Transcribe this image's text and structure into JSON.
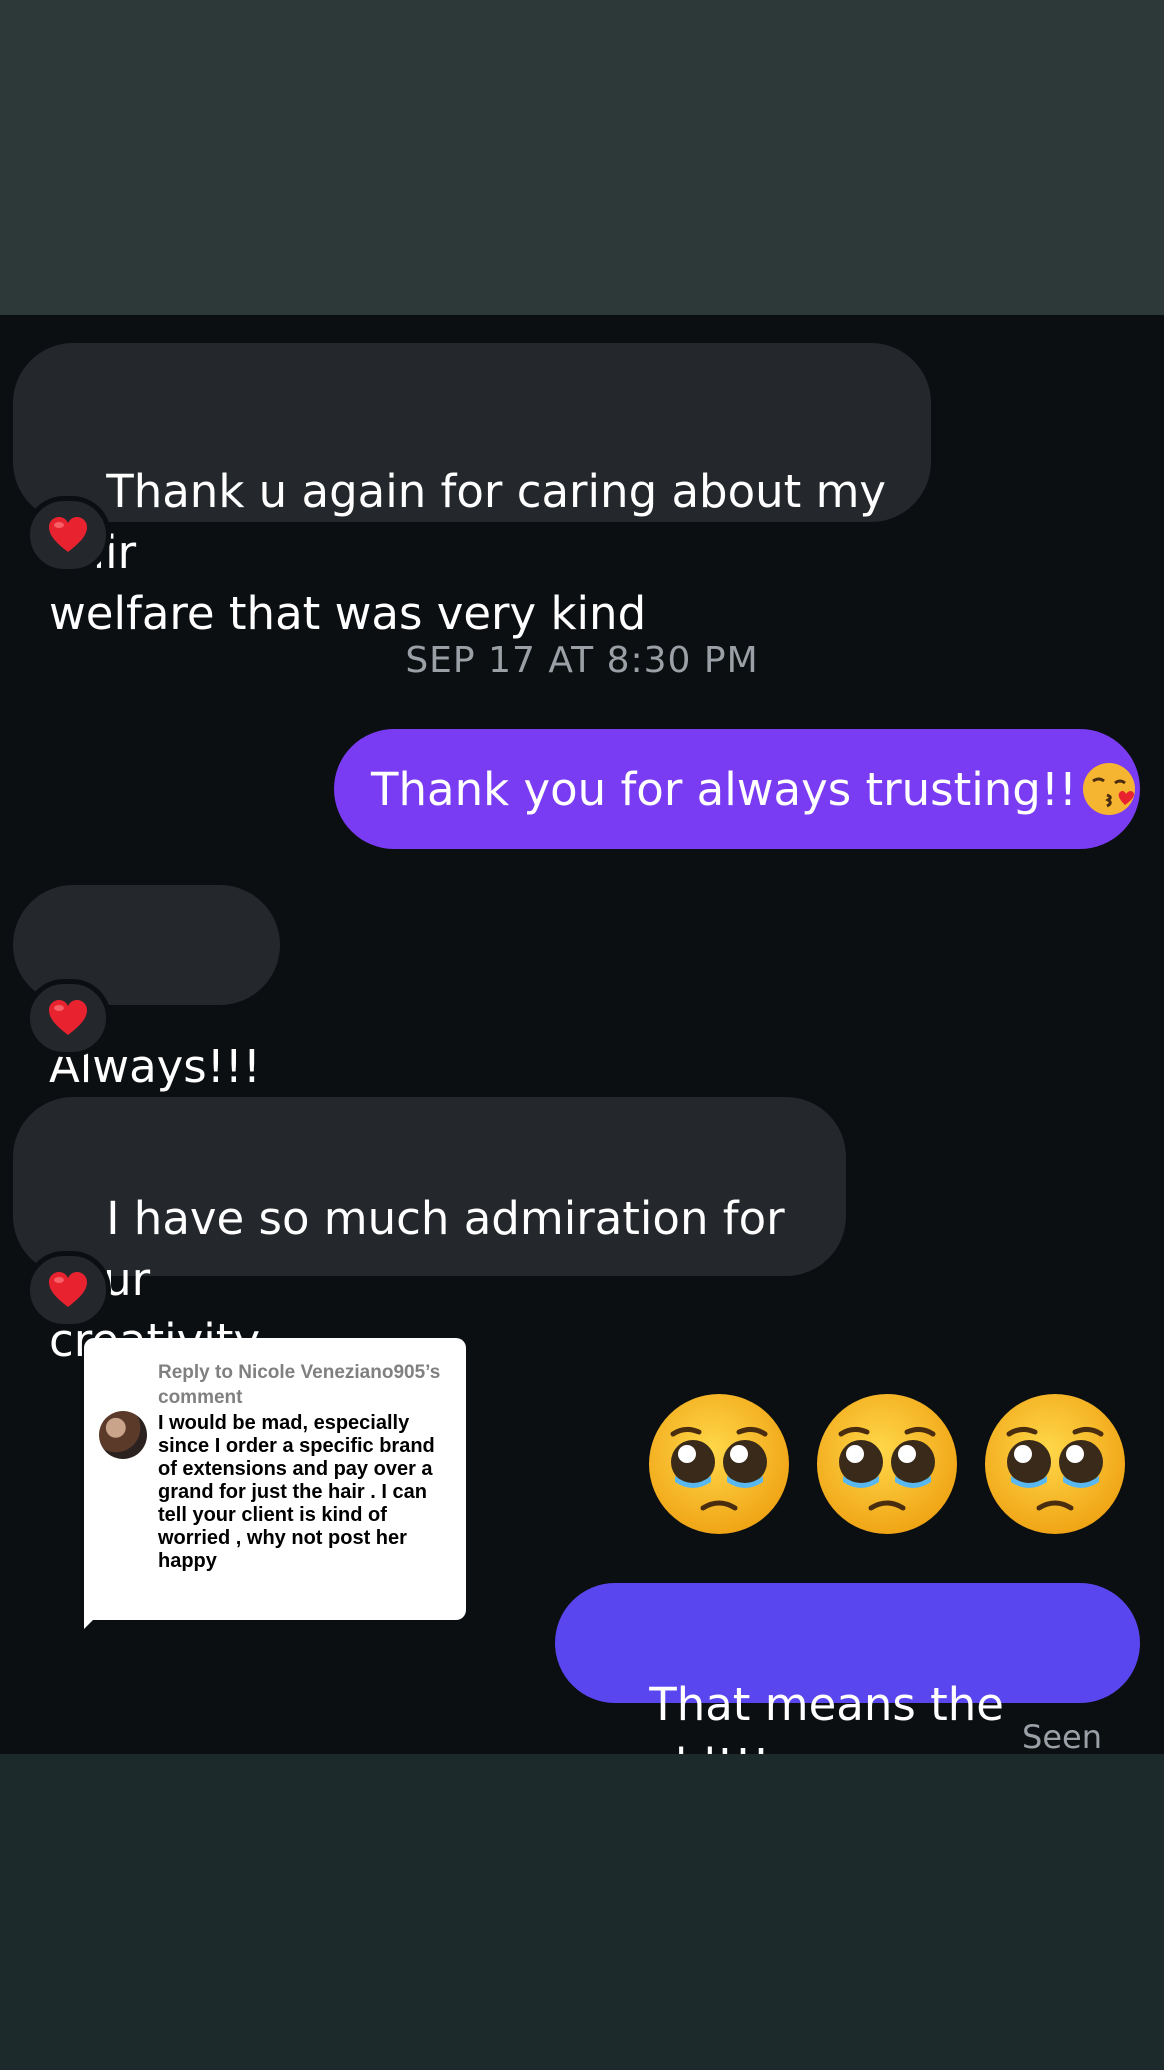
{
  "messages": {
    "m1": "Thank u again for caring about my hair\nwelfare that was very kind",
    "timestamp": "SEP 17 AT 8:30 PM",
    "m2": "Thank you for always trusting!!",
    "m3": "Always!!!",
    "m4": "I have so much admiration for your\ncreativity",
    "reply_head": "Reply to Nicole Veneziano905’s comment",
    "reply_body": "I would be mad, especially since I order a specific brand of extensions and pay over a grand for just the hair . I can tell your client is kind of worried , why not post her happy",
    "m5": "That means the world!!!",
    "seen": "Seen"
  },
  "reactions": [
    "heart-icon",
    "heart-icon",
    "heart-icon"
  ],
  "emojis": {
    "inline": "kissing-face-with-heart-icon",
    "row": [
      "pleading-face-icon",
      "pleading-face-icon",
      "pleading-face-icon"
    ]
  },
  "colors": {
    "incoming_bubble": "#24282c",
    "outgoing_purple": "#7a3cf2",
    "outgoing_indigo": "#5a46ee",
    "chat_background": "#0b0f12"
  }
}
